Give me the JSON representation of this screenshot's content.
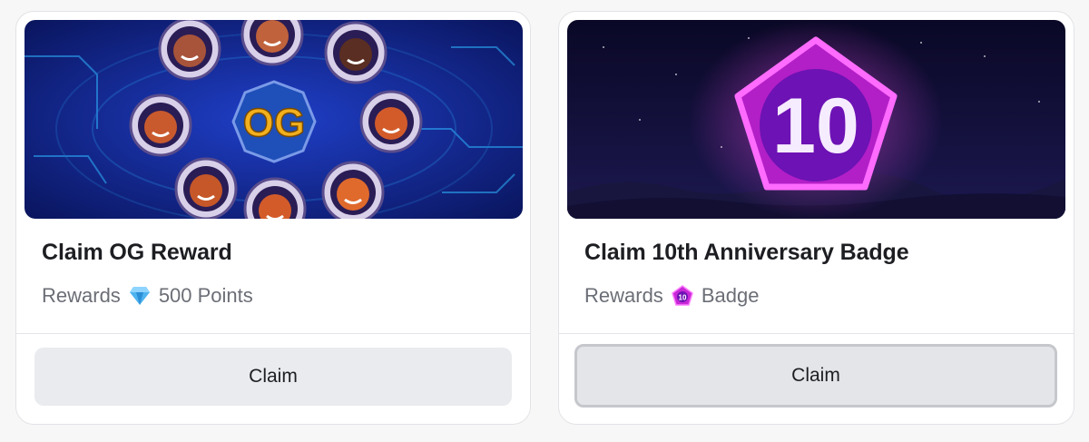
{
  "cards": [
    {
      "banner_alt": "OG astronauts banner",
      "title": "Claim OG Reward",
      "rewards_label": "Rewards",
      "reward_icon": "diamond-icon",
      "reward_value": "500 Points",
      "button_label": "Claim",
      "banner_text": "OG"
    },
    {
      "banner_alt": "10th anniversary pentagon badge banner",
      "title": "Claim 10th Anniversary Badge",
      "rewards_label": "Rewards",
      "reward_icon": "badge-10-icon",
      "reward_value": "Badge",
      "button_label": "Claim",
      "banner_text": "10"
    }
  ],
  "colors": {
    "card_bg": "#ffffff",
    "button_bg": "#eaebee",
    "og_banner_bg": "#0b1c78",
    "anniv_banner_bg": "#0c0a2e",
    "badge_magenta": "#e025e8",
    "og_gold": "#f2b01e"
  }
}
